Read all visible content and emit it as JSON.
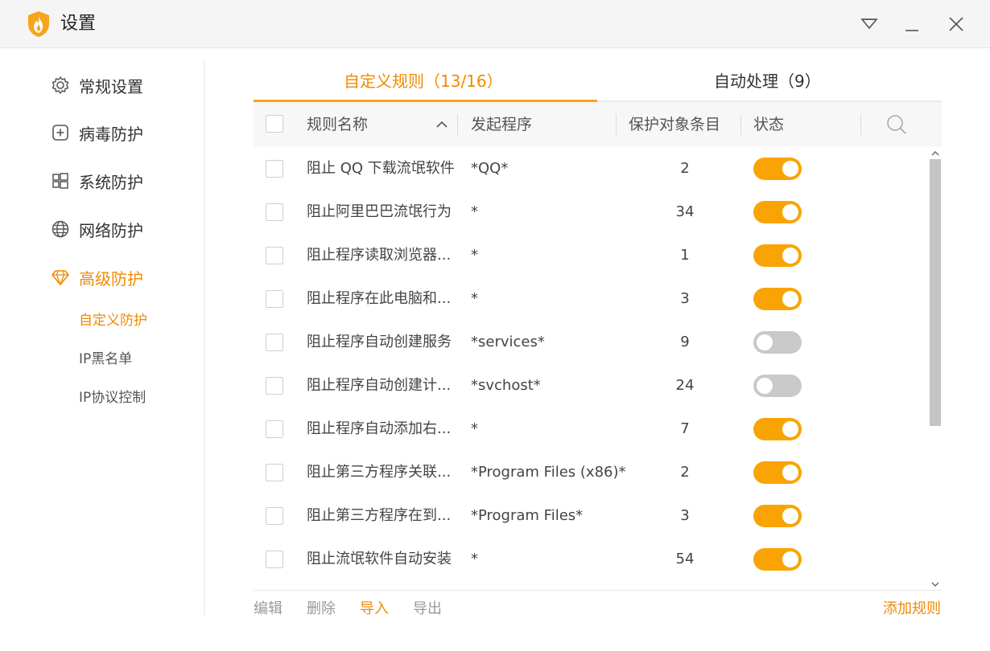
{
  "window": {
    "title": "设置",
    "icons": {
      "logo": "shield-flame-logo",
      "menu": "triangle-menu-icon",
      "minimize": "minimize-icon",
      "close": "close-icon"
    },
    "accent_color": "#f08a00",
    "toggle_on_color": "#f9a404"
  },
  "sidebar": {
    "items": [
      {
        "label": "常规设置",
        "icon": "gear-icon"
      },
      {
        "label": "病毒防护",
        "icon": "plus-square-icon"
      },
      {
        "label": "系统防护",
        "icon": "windows-icon"
      },
      {
        "label": "网络防护",
        "icon": "globe-icon"
      },
      {
        "label": "高级防护",
        "icon": "diamond-icon"
      }
    ],
    "subitems": [
      {
        "label": "自定义防护"
      },
      {
        "label": "IP黑名单"
      },
      {
        "label": "IP协议控制"
      }
    ]
  },
  "tabs": [
    {
      "label": "自定义规则（13/16）"
    },
    {
      "label": "自动处理（9）"
    }
  ],
  "table": {
    "headers": {
      "name": "规则名称",
      "program": "发起程序",
      "count": "保护对象条目",
      "status": "状态"
    },
    "rows": [
      {
        "name": "阻止 QQ 下载流氓软件",
        "program": "*QQ*",
        "count": "2",
        "enabled": true
      },
      {
        "name": "阻止阿里巴巴流氓行为",
        "program": "*",
        "count": "34",
        "enabled": true
      },
      {
        "name": "阻止程序读取浏览器...",
        "program": "*",
        "count": "1",
        "enabled": true
      },
      {
        "name": "阻止程序在此电脑和...",
        "program": "*",
        "count": "3",
        "enabled": true
      },
      {
        "name": "阻止程序自动创建服务",
        "program": "*services*",
        "count": "9",
        "enabled": false
      },
      {
        "name": "阻止程序自动创建计...",
        "program": "*svchost*",
        "count": "24",
        "enabled": false
      },
      {
        "name": "阻止程序自动添加右...",
        "program": "*",
        "count": "7",
        "enabled": true
      },
      {
        "name": "阻止第三方程序关联...",
        "program": "*Program Files (x86)*",
        "count": "2",
        "enabled": true
      },
      {
        "name": "阻止第三方程序在到...",
        "program": "*Program Files*",
        "count": "3",
        "enabled": true
      },
      {
        "name": "阻止流氓软件自动安装",
        "program": "*",
        "count": "54",
        "enabled": true
      }
    ]
  },
  "footer": {
    "edit": "编辑",
    "delete": "删除",
    "import": "导入",
    "export": "导出",
    "add_rule": "添加规则"
  }
}
